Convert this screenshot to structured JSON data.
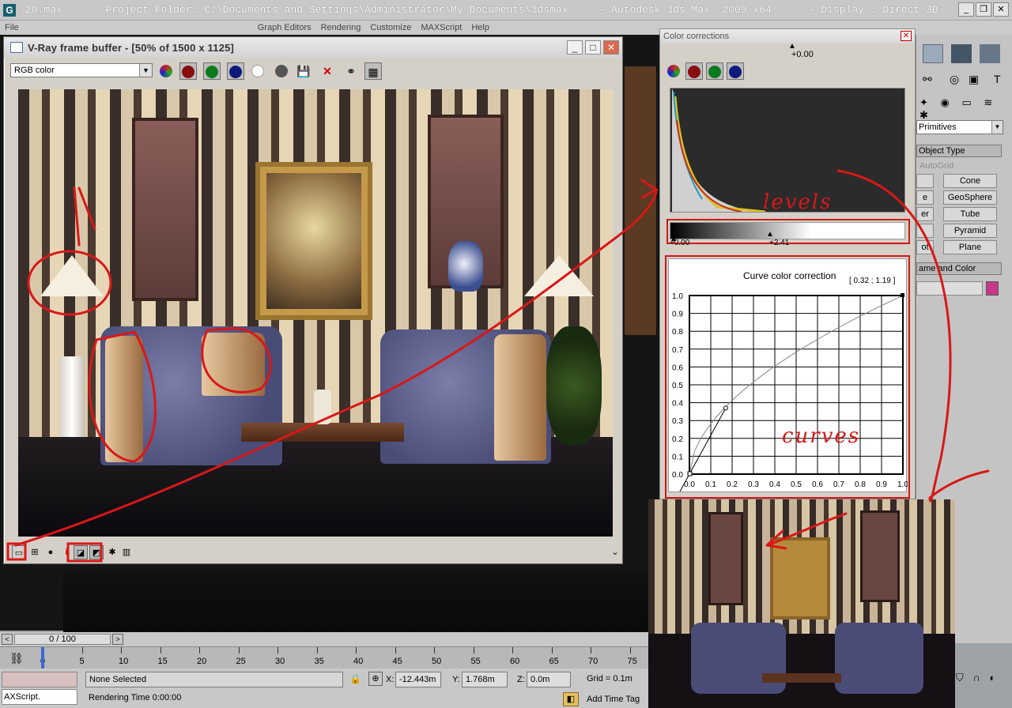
{
  "app": {
    "title": "20.max     - Project Folder: C:\\Documents and Settings\\Administrator\\My Documents\\3dsmax     - Autodesk 3ds Max  2009 x64      - Display : Direct 3D",
    "menu": [
      "File",
      "Graph Editors",
      "Rendering",
      "Customize",
      "MAXScript",
      "Help"
    ]
  },
  "vfb": {
    "title": "V-Ray frame buffer - [50% of 1500 x 1125]",
    "channel": "RGB color",
    "toolbar_icons": [
      "channel-rgb-icon",
      "red-channel-icon",
      "green-channel-icon",
      "blue-channel-icon",
      "alpha-icon",
      "mono-icon",
      "save-icon",
      "clear-icon",
      "link-icon",
      "region-render-icon"
    ],
    "bottom_icons": [
      "display-color-correction-icon",
      "force-color-clamping-icon",
      "lookup-icon",
      "info-icon",
      "levels-icon",
      "curve-icon",
      "srgb-icon",
      "lut-icon"
    ]
  },
  "color_corrections": {
    "title": "Color corrections",
    "exposure": "+0.00",
    "levels_min": "+0.00",
    "levels_mid": "+2.41",
    "curve_title": "Curve color correction",
    "curve_readout": "[ 0.32 ; 1.19 ]",
    "curve_ticks": [
      "0.0",
      "0.1",
      "0.2",
      "0.3",
      "0.4",
      "0.5",
      "0.6",
      "0.7",
      "0.8",
      "0.9",
      "1.0"
    ],
    "annotation_levels": "levels",
    "annotation_curves": "curves"
  },
  "command_panel": {
    "dropdown": "Primitives",
    "rollout_object_type": "Object Type",
    "autogrid": "AutoGrid",
    "buttons_right": [
      "Cone",
      "GeoSphere",
      "Tube",
      "Pyramid",
      "Plane"
    ],
    "buttons_left_partial": [
      "",
      "e",
      "er",
      "",
      "ot"
    ],
    "rollout_name_color": "ame and Color",
    "name_color_swatch": "#c8388a"
  },
  "timeline": {
    "frame_counter": "0 / 100",
    "ticks": [
      "0",
      "5",
      "10",
      "15",
      "20",
      "25",
      "30",
      "35",
      "40",
      "45",
      "50",
      "55",
      "60",
      "65",
      "70",
      "75"
    ]
  },
  "status": {
    "selection": "None Selected",
    "rendering_time": "Rendering Time  0:00:00",
    "maxscript": "AXScript.",
    "x_label": "X:",
    "x_value": "-12.443m",
    "y_label": "Y:",
    "y_value": "1.768m",
    "z_label": "Z:",
    "z_value": "0.0m",
    "grid": "Grid = 0.1m",
    "add_time_tag": "Add Time Tag"
  }
}
